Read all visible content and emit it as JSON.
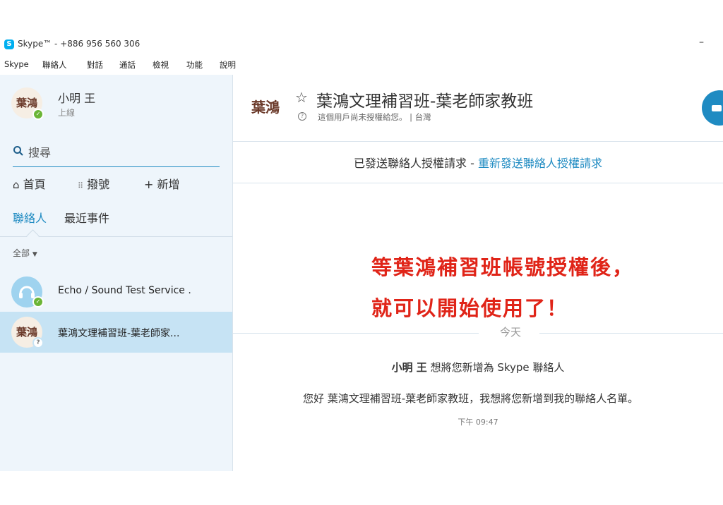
{
  "window": {
    "title": "Skype™ - +886 956 560 306",
    "app_icon_letter": "S",
    "minimize_glyph": "–"
  },
  "menu": [
    "Skype",
    "聯絡人",
    "對話",
    "通話",
    "檢視",
    "功能",
    "說明"
  ],
  "profile": {
    "name": "小明 王",
    "status": "上線",
    "avatar_text": "葉鴻"
  },
  "search": {
    "placeholder": "搜尋"
  },
  "nav": {
    "home": "首頁",
    "dial": "撥號",
    "add": "新增"
  },
  "tabs": [
    "聯絡人",
    "最近事件"
  ],
  "filter": "全部",
  "contacts": [
    {
      "name": "Echo / Sound Test Service .",
      "status": "online"
    },
    {
      "name": "葉鴻文理補習班-葉老師家...",
      "status": "pending",
      "avatar_text": "葉鴻"
    }
  ],
  "conversation": {
    "title": "葉鴻文理補習班-葉老師家教班",
    "subtitle": "這個用戶尚未授權給您。 | 台灣",
    "request_sent": "已發送聯絡人授權請求 -",
    "resend_link": "重新發送聯絡人授權請求",
    "annotation_line1": "等葉鴻補習班帳號授權後，",
    "annotation_line2": "就可以開始使用了！",
    "date_separator": "今天",
    "message_sender": "小明 王",
    "message_action": "想將您新增為 Skype 聯絡人",
    "message_text": "您好 葉鴻文理補習班-葉老師家教班，我想將您新增到我的聯絡人名單。",
    "message_time": "下午 09:47"
  },
  "colors": {
    "accent": "#1f8bc2",
    "sidebar_bg": "#eef5fb",
    "selected_bg": "#c6e3f4",
    "online": "#6bb536",
    "annotation": "#e02418"
  }
}
